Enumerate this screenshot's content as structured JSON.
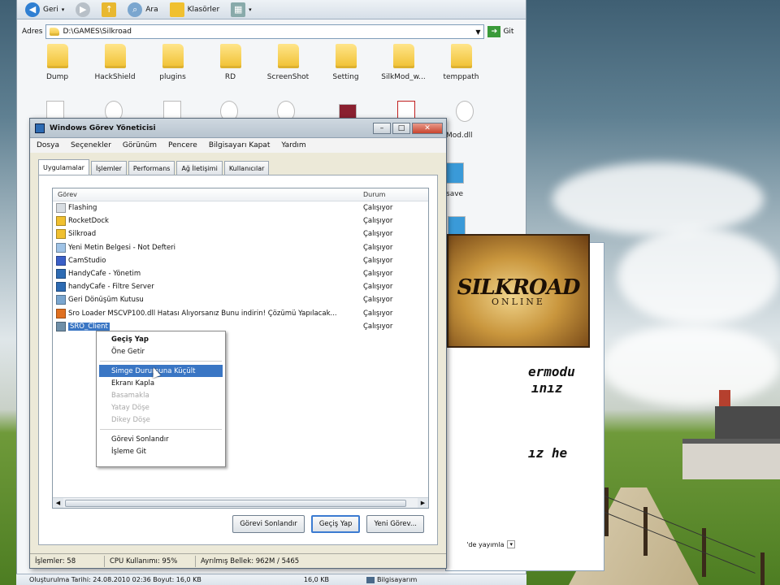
{
  "explorer": {
    "toolbar": {
      "back_label": "Geri",
      "search_label": "Ara",
      "folders_label": "Klasörler"
    },
    "address": {
      "label": "Adres",
      "path": "D:\\GAMES\\Silkroad",
      "go_label": "Git"
    },
    "folders": [
      "Dump",
      "HackShield",
      "plugins",
      "RD",
      "ScreenShot",
      "Setting",
      "SilkMod_w...",
      "temppath"
    ],
    "file_labels": [
      "Mod.dll",
      "save"
    ],
    "side_link": "'de yayımla",
    "details": {
      "created": "Oluşturulma Tarihi: 24.08.2010 02:36 Boyut: 16,0 KB",
      "size": "16,0 KB",
      "computer": "Bilgisayarım"
    }
  },
  "sro_popup": {
    "logo": "SILKROAD",
    "logo_sub": "ONLINE",
    "lines": [
      "ermodu",
      "ınız",
      "ız he"
    ]
  },
  "taskmgr": {
    "title": "Windows Görev Yöneticisi",
    "menu": [
      "Dosya",
      "Seçenekler",
      "Görünüm",
      "Pencere",
      "Bilgisayarı Kapat",
      "Yardım"
    ],
    "tabs": [
      "Uygulamalar",
      "İşlemler",
      "Performans",
      "Ağ İletişimi",
      "Kullanıcılar"
    ],
    "columns": {
      "task": "Görev",
      "status": "Durum"
    },
    "rows": [
      {
        "task": "Flashing",
        "status": "Çalışıyor",
        "icon_color": "#d8dde2"
      },
      {
        "task": "RocketDock",
        "status": "Çalışıyor",
        "icon_color": "#f0c030"
      },
      {
        "task": "Silkroad",
        "status": "Çalışıyor",
        "icon_color": "#f0c030"
      },
      {
        "task": "Yeni Metin Belgesi - Not Defteri",
        "status": "Çalışıyor",
        "icon_color": "#9fc3e6"
      },
      {
        "task": "CamStudio",
        "status": "Çalışıyor",
        "icon_color": "#3a5fc8"
      },
      {
        "task": "HandyCafe - Yönetim",
        "status": "Çalışıyor",
        "icon_color": "#2d6bb3"
      },
      {
        "task": "handyCafe - Filtre Server",
        "status": "Çalışıyor",
        "icon_color": "#2d6bb3"
      },
      {
        "task": "Geri Dönüşüm Kutusu",
        "status": "Çalışıyor",
        "icon_color": "#7aa6cf"
      },
      {
        "task": "Sro Loader MSCVP100.dll Hatası Alıyorsanız Bunu indirin! Çözümü Yapılacak...",
        "status": "Çalışıyor",
        "icon_color": "#e07020"
      },
      {
        "task": "SRO_Client",
        "status": "Çalışıyor",
        "icon_color": "#6f8fa8",
        "selected": true
      }
    ],
    "buttons": {
      "end_task": "Görevi Sonlandır",
      "switch_to": "Geçiş Yap",
      "new_task": "Yeni Görev..."
    },
    "status": {
      "processes": "İşlemler: 58",
      "cpu": "CPU Kullanımı: 95%",
      "memory": "Ayrılmış Bellek: 962M / 5465"
    }
  },
  "context_menu": {
    "items": [
      {
        "label": "Geçiş Yap",
        "style": "bold"
      },
      {
        "label": "Öne Getir",
        "style": ""
      },
      {
        "sep": true
      },
      {
        "label": "Simge Durumuna Küçült",
        "style": "hl"
      },
      {
        "label": "Ekranı Kapla",
        "style": ""
      },
      {
        "label": "Basamakla",
        "style": "disabled"
      },
      {
        "label": "Yatay Döşe",
        "style": "disabled"
      },
      {
        "label": "Dikey Döşe",
        "style": "disabled"
      },
      {
        "sep": true
      },
      {
        "label": "Görevi Sonlandır",
        "style": ""
      },
      {
        "label": "İşleme Git",
        "style": ""
      }
    ]
  }
}
